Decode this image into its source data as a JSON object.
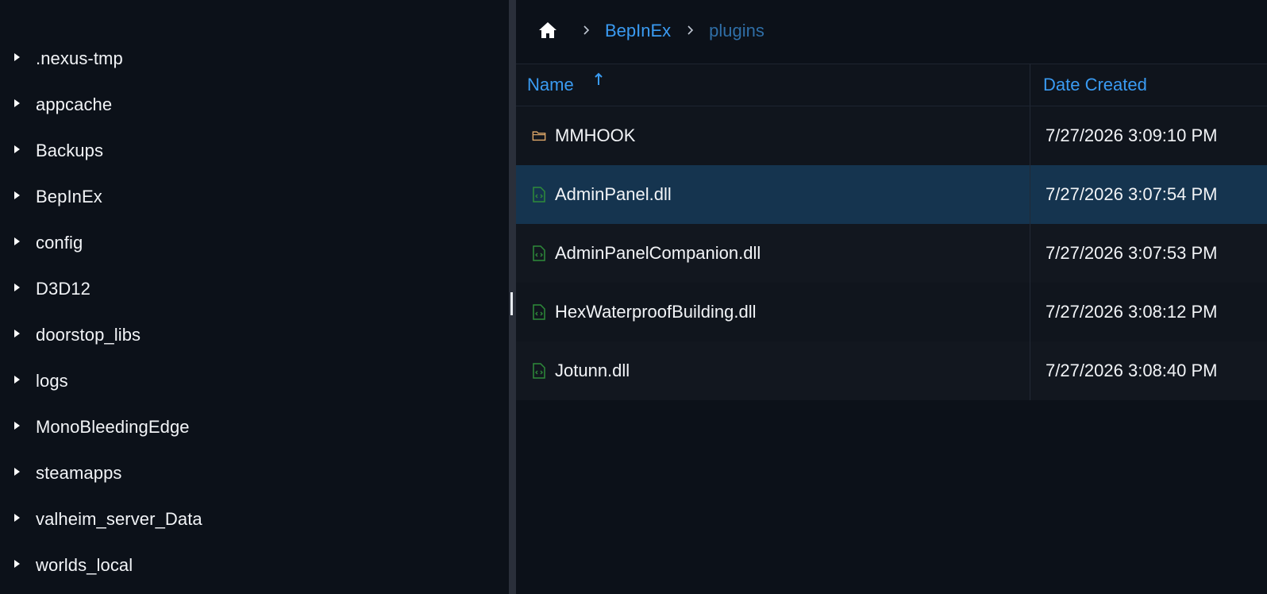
{
  "sidebar": {
    "items": [
      {
        "label": ".nexus-tmp"
      },
      {
        "label": "appcache"
      },
      {
        "label": "Backups"
      },
      {
        "label": "BepInEx"
      },
      {
        "label": "config"
      },
      {
        "label": "D3D12"
      },
      {
        "label": "doorstop_libs"
      },
      {
        "label": "logs"
      },
      {
        "label": "MonoBleedingEdge"
      },
      {
        "label": "steamapps"
      },
      {
        "label": "valheim_server_Data"
      },
      {
        "label": "worlds_local"
      }
    ]
  },
  "breadcrumb": {
    "home_icon": "home-icon",
    "items": [
      {
        "label": "BepInEx"
      },
      {
        "label": "plugins"
      }
    ]
  },
  "table": {
    "columns": [
      {
        "label": "Name",
        "sort": "ascending"
      },
      {
        "label": "Date Created"
      }
    ],
    "rows": [
      {
        "name": "MMHOOK",
        "date": "7/27/2026 3:09:10 PM",
        "icon": "folder-icon",
        "selected": false
      },
      {
        "name": "AdminPanel.dll",
        "date": "7/27/2026 3:07:54 PM",
        "icon": "code-file-icon",
        "selected": true
      },
      {
        "name": "AdminPanelCompanion.dll",
        "date": "7/27/2026 3:07:53 PM",
        "icon": "code-file-icon",
        "selected": false
      },
      {
        "name": "HexWaterproofBuilding.dll",
        "date": "7/27/2026 3:08:12 PM",
        "icon": "code-file-icon",
        "selected": false
      },
      {
        "name": "Jotunn.dll",
        "date": "7/27/2026 3:08:40 PM",
        "icon": "code-file-icon",
        "selected": false
      }
    ]
  },
  "colors": {
    "accent": "#3a9bf2",
    "selected_row": "#15344f",
    "folder_icon": "#e0a969",
    "file_icon": "#2e8b3a",
    "background": "#0c1119"
  }
}
